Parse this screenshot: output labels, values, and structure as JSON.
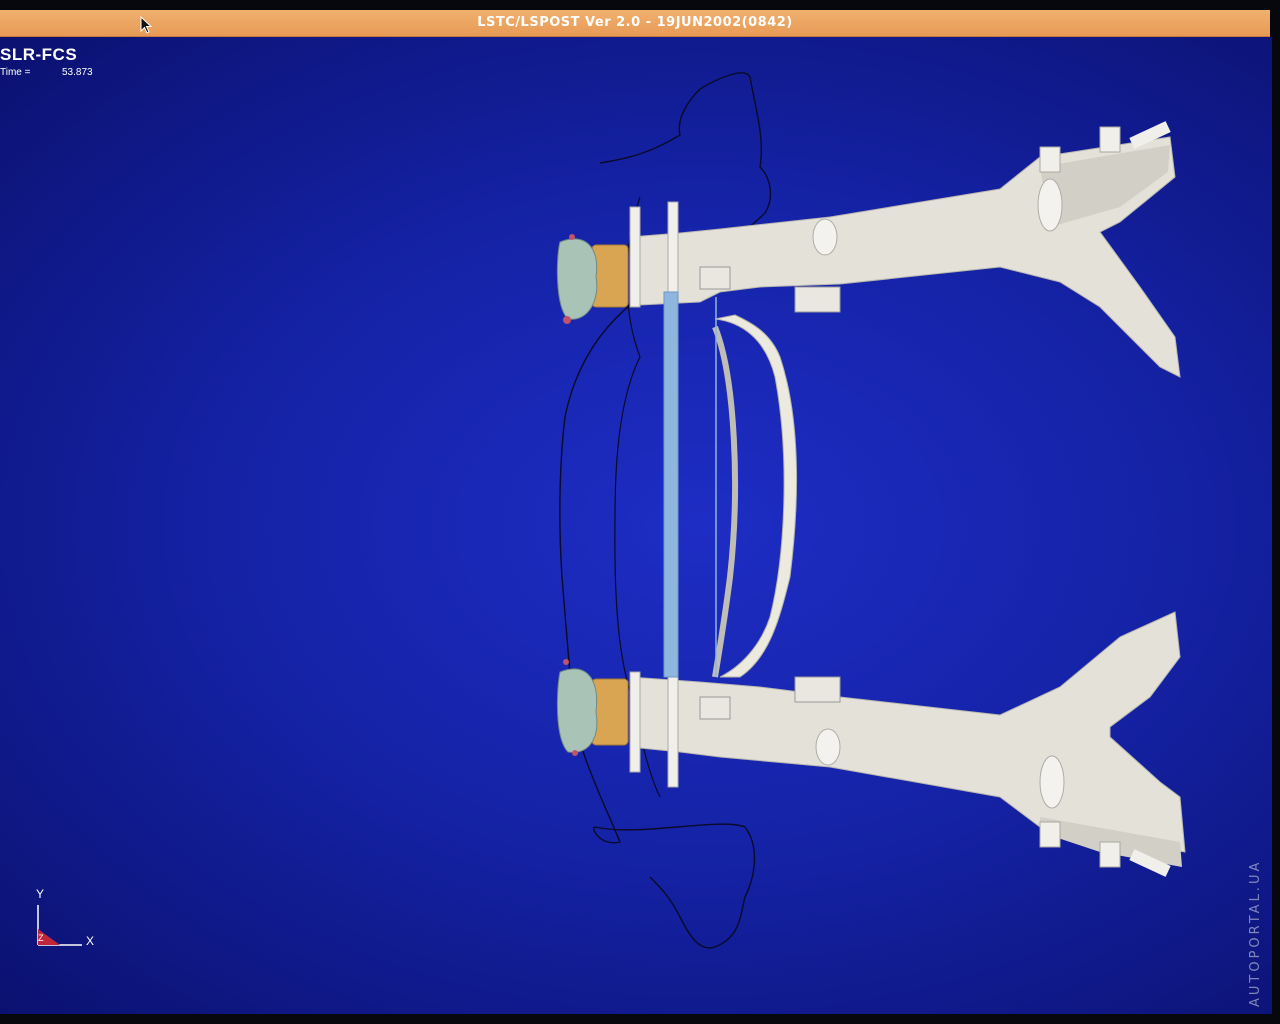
{
  "window": {
    "title": "LSTC/LSPOST Ver 2.0 - 19JUN2002(0842)"
  },
  "viewport": {
    "model_name": "SLR-FCS",
    "time_label": "Time =",
    "time_value": "53.873",
    "background_color": "#1523a8"
  },
  "axis_triad": {
    "y_label": "Y",
    "x_label": "X",
    "z_label": "Z"
  },
  "watermark": {
    "text": "AUTOPORTAL.UA"
  },
  "colors": {
    "frame_part": "#e4e1d8",
    "wheel_hub": "#d9a552",
    "shaft": "#8eb6df",
    "outline": "#0a0a2a"
  }
}
